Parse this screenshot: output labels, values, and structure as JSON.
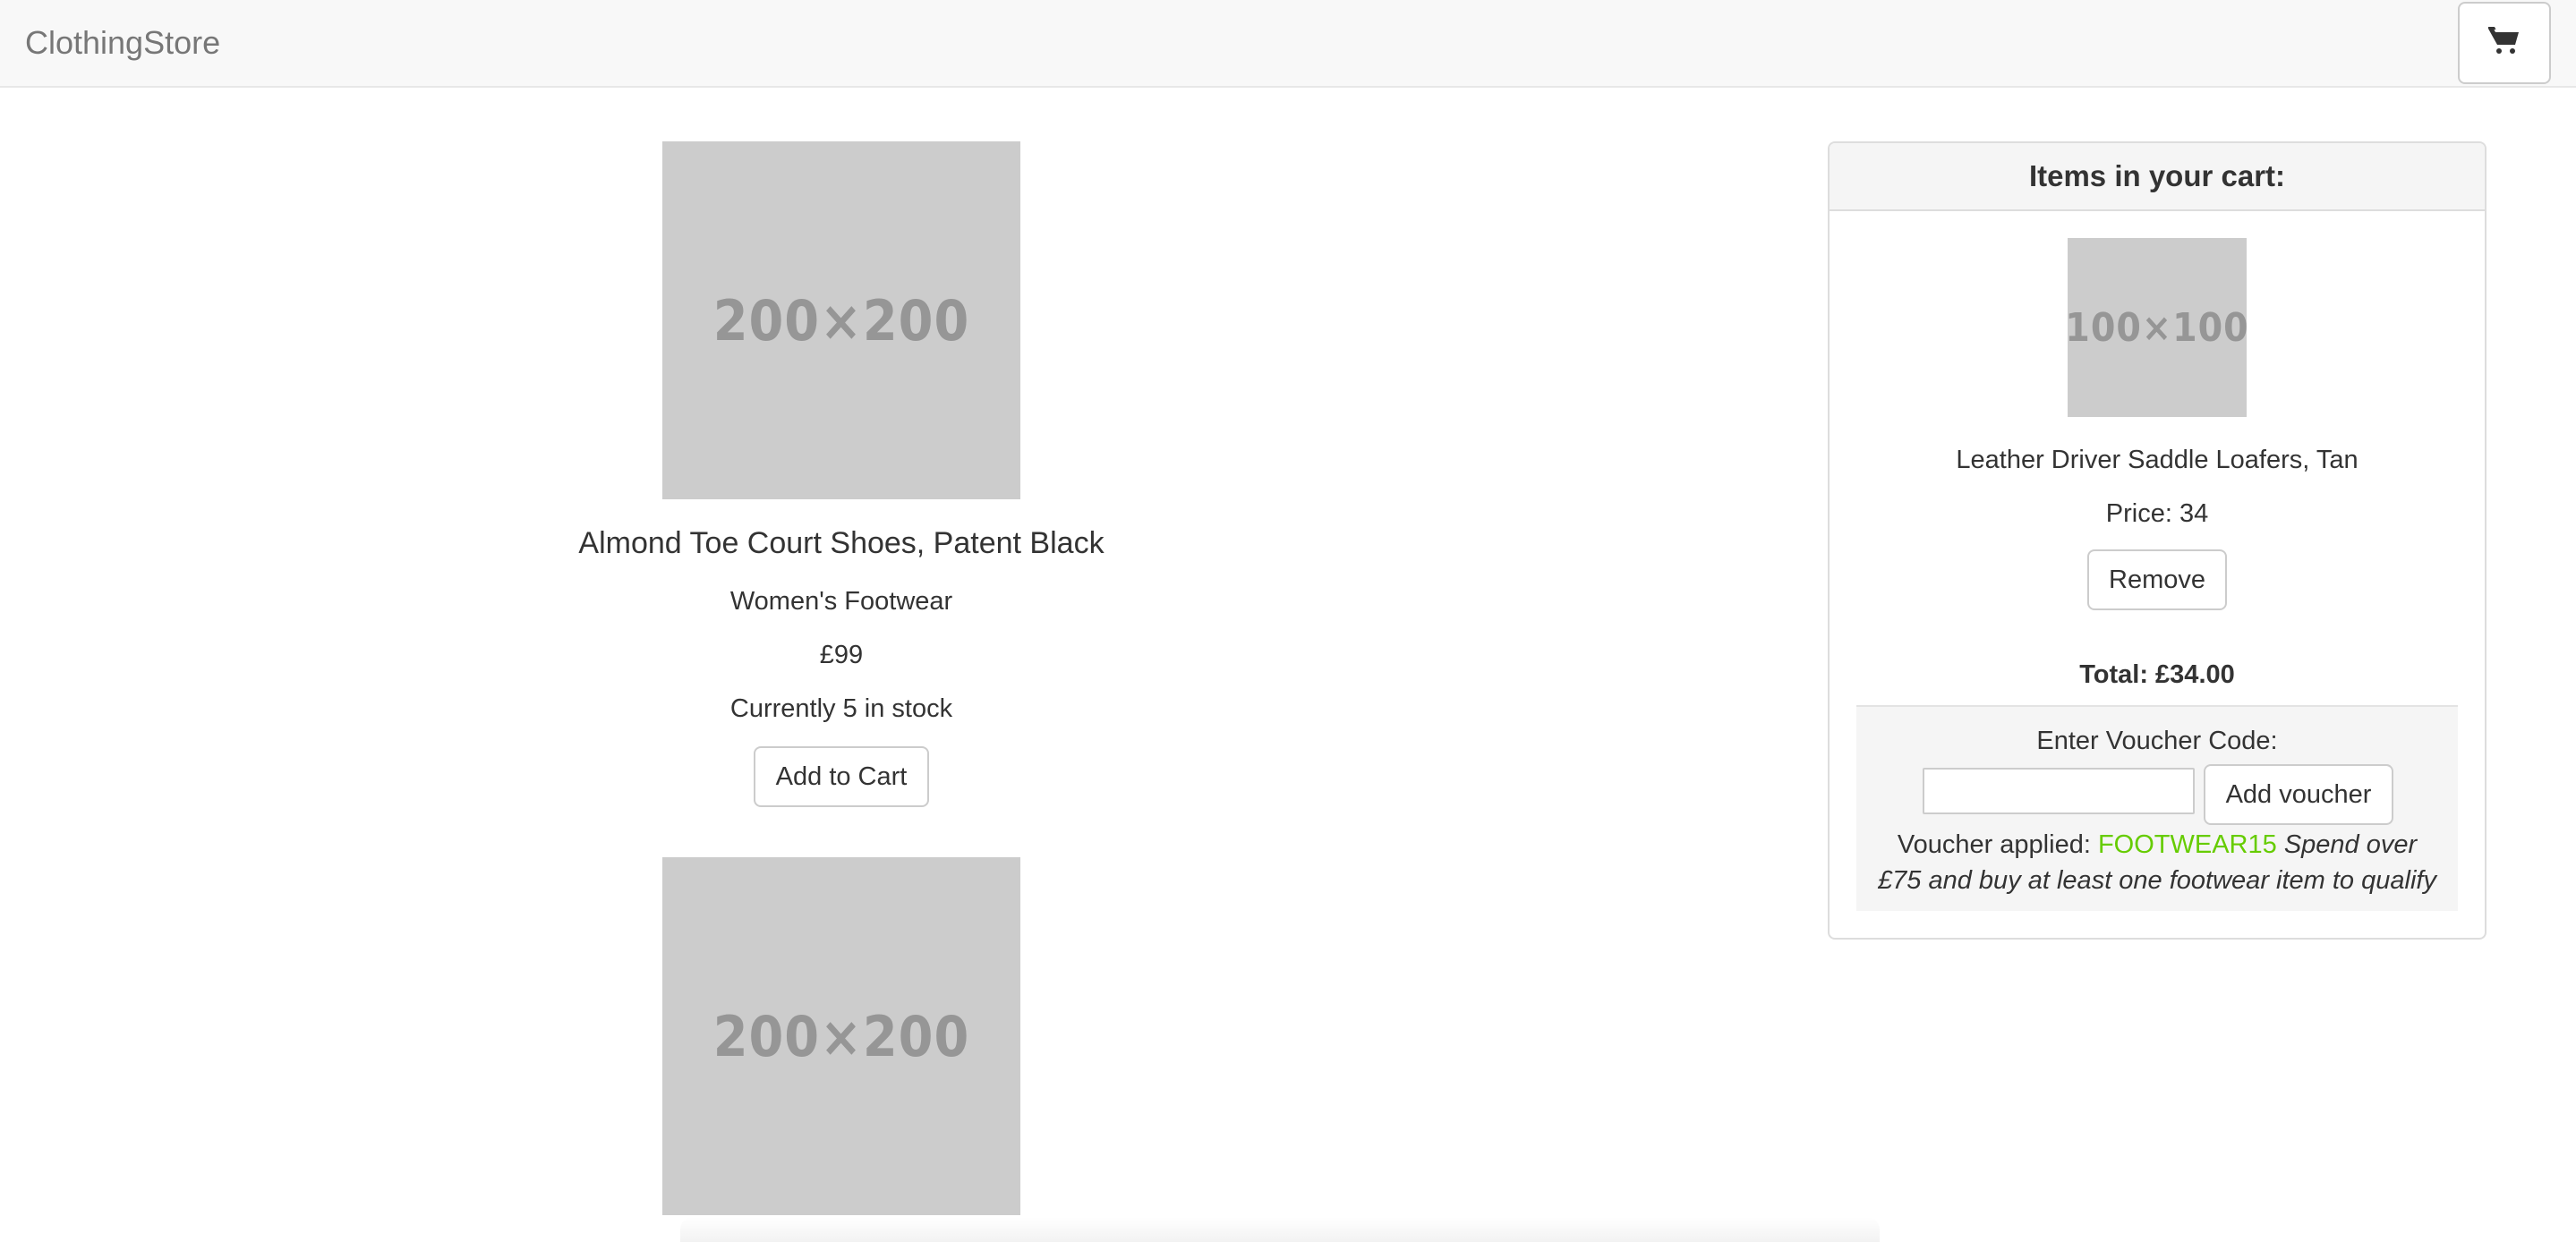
{
  "navbar": {
    "brand": "ClothingStore",
    "cart_icon": "shopping-cart-icon"
  },
  "products": [
    {
      "image_label": "200×200",
      "name": "Almond Toe Court Shoes, Patent Black",
      "category": "Women's Footwear",
      "price": "£99",
      "stock": "Currently 5 in stock",
      "add_label": "Add to Cart"
    },
    {
      "image_label": "200×200"
    }
  ],
  "cart": {
    "heading": "Items in your cart:",
    "items": [
      {
        "image_label": "100×100",
        "name": "Leather Driver Saddle Loafers, Tan",
        "price": "Price: 34",
        "remove_label": "Remove"
      }
    ],
    "total": "Total: £34.00",
    "voucher": {
      "label": "Enter Voucher Code:",
      "input_value": "",
      "input_placeholder": "",
      "button_label": "Add voucher",
      "applied_prefix": "Voucher applied:",
      "applied_code": "FOOTWEAR15",
      "applied_description": "Spend over £75 and buy at least one footwear item to qualify"
    }
  },
  "colors": {
    "voucher_code": "#66cc00",
    "placeholder_bg": "#cccccc",
    "navbar_bg": "#f8f8f8"
  }
}
